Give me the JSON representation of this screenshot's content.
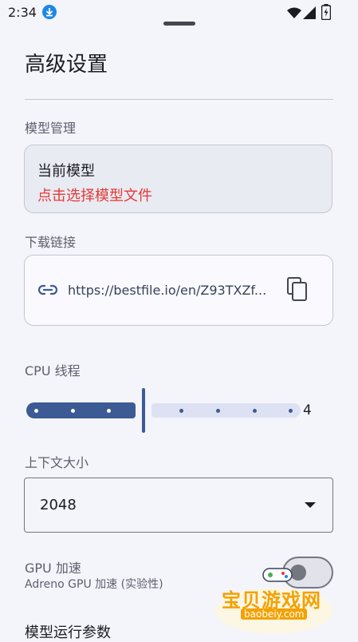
{
  "status_bar": {
    "time": "2:34"
  },
  "page": {
    "title": "高级设置"
  },
  "model_section": {
    "label": "模型管理",
    "card_title": "当前模型",
    "card_hint": "点击选择模型文件",
    "hint_color": "#e53935"
  },
  "download_section": {
    "label": "下载链接",
    "url": "https://bestfile.io/en/Z93TXZf..."
  },
  "cpu_section": {
    "label": "CPU 线程",
    "value": "4",
    "value_fraction": 0.375
  },
  "context_section": {
    "label": "上下文大小",
    "selected": "2048"
  },
  "gpu_section": {
    "title": "GPU 加速",
    "subtitle": "Adreno GPU 加速 (实验性)",
    "enabled": false
  },
  "next_section": {
    "label": "模型运行参数"
  },
  "watermark": {
    "text": "宝贝游戏网",
    "sub": "baobeiy.com"
  },
  "colors": {
    "accent": "#3c5a94",
    "background": "#f4f4fb",
    "error": "#e53935"
  }
}
